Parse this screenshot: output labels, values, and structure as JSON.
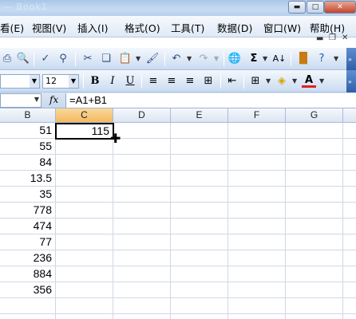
{
  "window": {
    "title": "— Book1"
  },
  "menu": {
    "items": [
      "看(E)",
      "视图(V)",
      "插入(I)",
      "格式(O)",
      "工具(T)",
      "数据(D)",
      "窗口(W)",
      "帮助(H)"
    ]
  },
  "toolbar2": {
    "font_size": "12"
  },
  "formula_bar": {
    "fx_label": "fx",
    "formula": "=A1+B1"
  },
  "columns": [
    "B",
    "C",
    "D",
    "E",
    "F",
    "G"
  ],
  "column_b_values": [
    "51",
    "55",
    "84",
    "13.5",
    "35",
    "778",
    "474",
    "77",
    "236",
    "884",
    "356"
  ],
  "active_cell": {
    "column": "C",
    "row": 1,
    "value": "115"
  }
}
